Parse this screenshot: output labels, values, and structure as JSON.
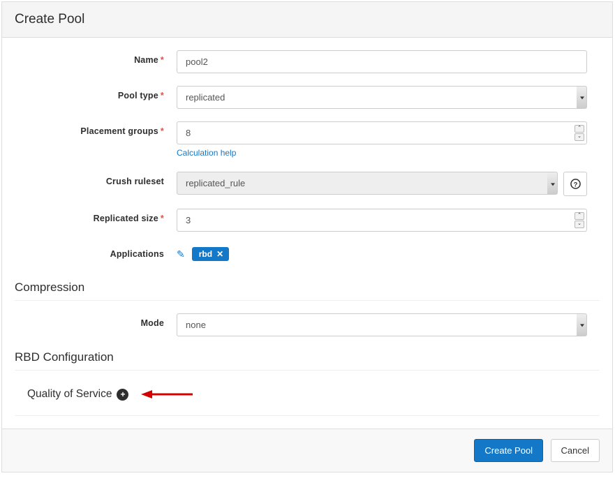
{
  "header": {
    "title": "Create Pool"
  },
  "form": {
    "name": {
      "label": "Name",
      "value": "pool2"
    },
    "pool_type": {
      "label": "Pool type",
      "value": "replicated"
    },
    "pg": {
      "label": "Placement groups",
      "value": "8",
      "help": "Calculation help"
    },
    "crush": {
      "label": "Crush ruleset",
      "value": "replicated_rule"
    },
    "replicated_size": {
      "label": "Replicated size",
      "value": "3"
    },
    "applications": {
      "label": "Applications",
      "tag": "rbd"
    }
  },
  "compression": {
    "heading": "Compression",
    "mode_label": "Mode",
    "mode_value": "none"
  },
  "rbd": {
    "heading": "RBD Configuration",
    "qos_label": "Quality of Service"
  },
  "footer": {
    "create": "Create Pool",
    "cancel": "Cancel"
  },
  "icons": {
    "question": "?",
    "pencil": "✎",
    "close": "✕",
    "up": "⌃",
    "down": "⌄",
    "plus": "+"
  }
}
